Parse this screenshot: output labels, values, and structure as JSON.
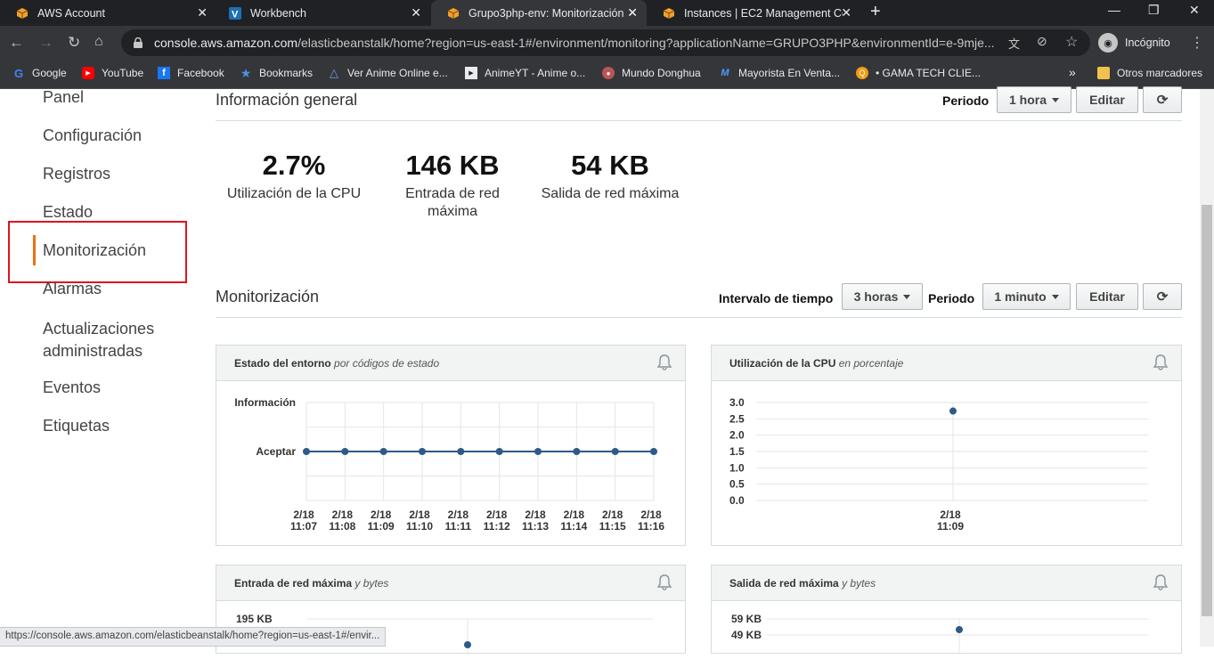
{
  "browser": {
    "tabs": [
      {
        "title": "AWS Account",
        "icon": "aws-box-icon",
        "active": false
      },
      {
        "title": "Workbench",
        "icon": "vocareum-icon",
        "active": false
      },
      {
        "title": "Grupo3php-env: Monitorización",
        "icon": "aws-box-icon",
        "active": true
      },
      {
        "title": "Instances | EC2 Management Con",
        "icon": "aws-box-icon",
        "active": false
      }
    ],
    "url_host": "console.aws.amazon.com",
    "url_path": "/elasticbeanstalk/home?region=us-east-1#/environment/monitoring?applicationName=GRUPO3PHP&environmentId=e-9mje...",
    "profile_label": "Incógnito",
    "bookmarks": [
      {
        "label": "Google",
        "icon": "google-icon"
      },
      {
        "label": "YouTube",
        "icon": "youtube-icon"
      },
      {
        "label": "Facebook",
        "icon": "facebook-icon"
      },
      {
        "label": "Bookmarks",
        "icon": "star-icon"
      },
      {
        "label": "Ver Anime Online e...",
        "icon": "anime-icon"
      },
      {
        "label": "AnimeYT - Anime o...",
        "icon": "play-icon"
      },
      {
        "label": "Mundo Donghua",
        "icon": "donghua-icon"
      },
      {
        "label": "Mayorista En Venta...",
        "icon": "mayorista-icon"
      },
      {
        "label": "• GAMA TECH CLIE...",
        "icon": "gama-icon"
      }
    ],
    "other_bookmarks": "Otros marcadores",
    "status_url": "https://console.aws.amazon.com/elasticbeanstalk/home?region=us-east-1#/envir..."
  },
  "sidebar": {
    "items": [
      "Panel",
      "Configuración",
      "Registros",
      "Estado",
      "Monitorización",
      "Alarmas",
      "Actualizaciones administradas",
      "Eventos",
      "Etiquetas"
    ],
    "active": "Monitorización"
  },
  "overview": {
    "title": "Información general",
    "period_label": "Periodo",
    "period_value": "1 hora",
    "edit": "Editar",
    "metrics": [
      {
        "value": "2.7%",
        "label": "Utilización de la CPU"
      },
      {
        "value": "146 KB",
        "label": "Entrada de red máxima"
      },
      {
        "value": "54 KB",
        "label": "Salida de red máxima"
      }
    ]
  },
  "monitoring": {
    "title": "Monitorización",
    "interval_label": "Intervalo de tiempo",
    "interval_value": "3 horas",
    "period_label": "Periodo",
    "period_value": "1 minuto",
    "edit": "Editar"
  },
  "panels": {
    "env": {
      "title": "Estado del entorno",
      "subtitle": "por códigos de estado"
    },
    "cpu": {
      "title": "Utilización de la CPU",
      "subtitle": "en porcentaje"
    },
    "netin": {
      "title": "Entrada de red máxima",
      "subtitle": "y bytes"
    },
    "netout": {
      "title": "Salida de red máxima",
      "subtitle": "y bytes"
    }
  },
  "chart_data": [
    {
      "type": "line",
      "title": "Estado del entorno",
      "y_categories": [
        "Información",
        "Aceptar"
      ],
      "x": [
        "2/18 11:07",
        "2/18 11:08",
        "2/18 11:09",
        "2/18 11:10",
        "2/18 11:11",
        "2/18 11:12",
        "2/18 11:13",
        "2/18 11:14",
        "2/18 11:15",
        "2/18 11:16"
      ],
      "values": [
        "Aceptar",
        "Aceptar",
        "Aceptar",
        "Aceptar",
        "Aceptar",
        "Aceptar",
        "Aceptar",
        "Aceptar",
        "Aceptar",
        "Aceptar"
      ],
      "color": "#2e5a88"
    },
    {
      "type": "scatter",
      "title": "Utilización de la CPU",
      "yticks": [
        "3.0",
        "2.5",
        "2.0",
        "1.5",
        "1.0",
        "0.5",
        "0.0"
      ],
      "ylim": [
        0,
        3.0
      ],
      "x": [
        "2/18 11:09"
      ],
      "values": [
        2.74
      ],
      "color": "#2e5a88"
    },
    {
      "type": "scatter",
      "title": "Entrada de red máxima",
      "yticks": [
        "195 KB"
      ]
    },
    {
      "type": "scatter",
      "title": "Salida de red máxima",
      "yticks": [
        "59 KB",
        "49 KB"
      ]
    }
  ]
}
